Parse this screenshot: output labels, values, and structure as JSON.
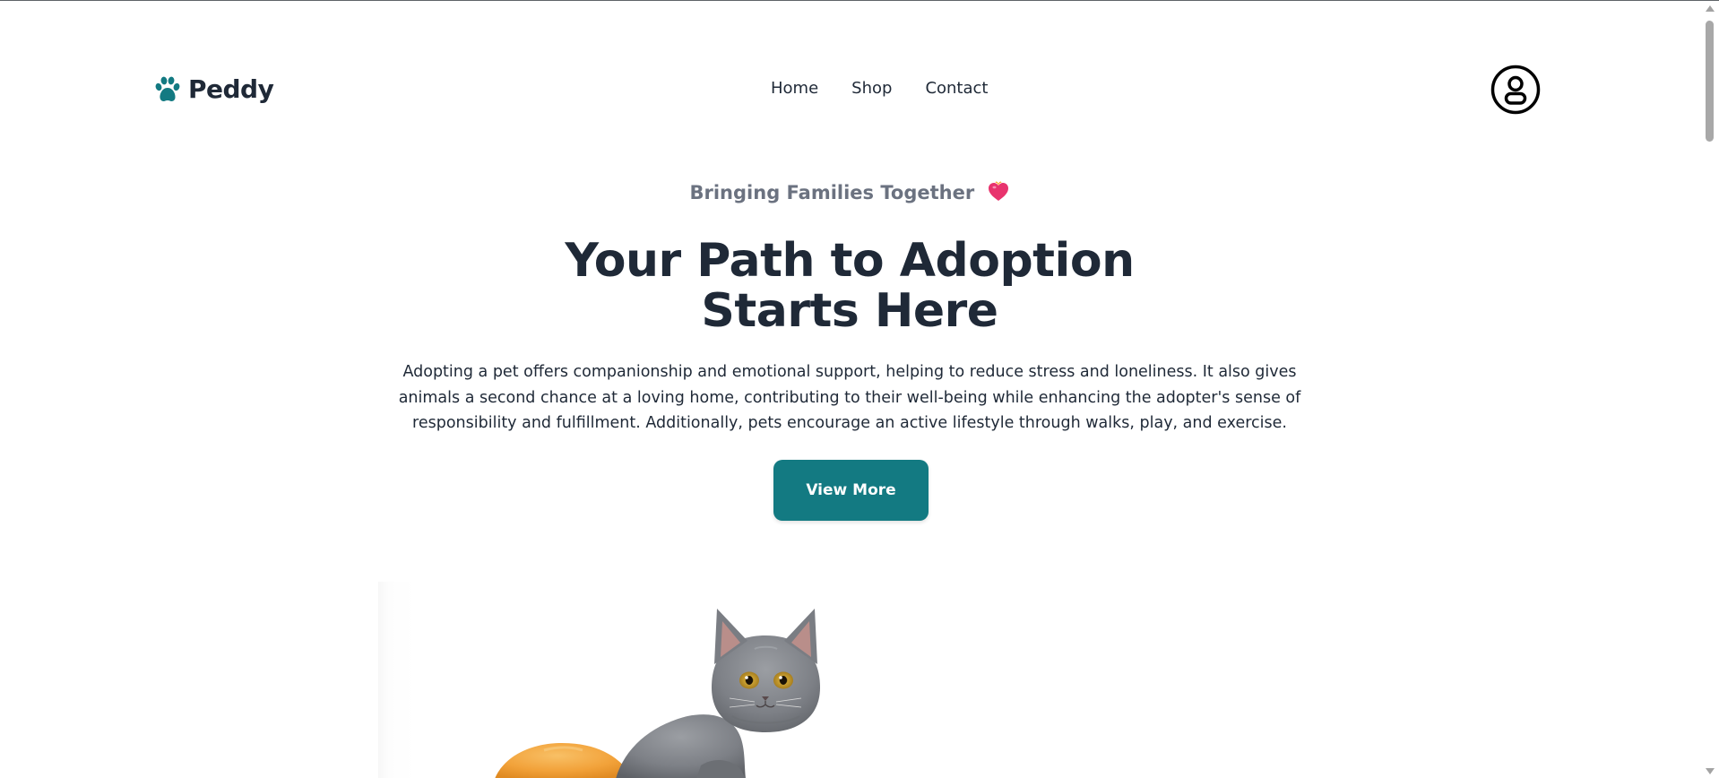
{
  "header": {
    "brand": "Peddy",
    "nav": [
      {
        "label": "Home"
      },
      {
        "label": "Shop"
      },
      {
        "label": "Contact"
      }
    ]
  },
  "hero": {
    "tagline": "Bringing Families Together",
    "headline_line1": "Your Path to Adoption",
    "headline_line2": "Starts Here",
    "description": "Adopting a pet offers companionship and emotional support, helping to reduce stress and loneliness. It also gives animals a second chance at a loving home, contributing to their well-being while enhancing the adopter's sense of responsibility and fulfillment. Additionally, pets encourage an active lifestyle through walks, play, and exercise.",
    "cta_label": "View More"
  },
  "colors": {
    "accent": "#137a82",
    "heading": "#1f2937",
    "muted": "#6b7280",
    "heart": "#e8336d"
  },
  "icons": {
    "logo": "paw-icon",
    "tagline": "heart-icon",
    "account": "user-circle-icon"
  }
}
